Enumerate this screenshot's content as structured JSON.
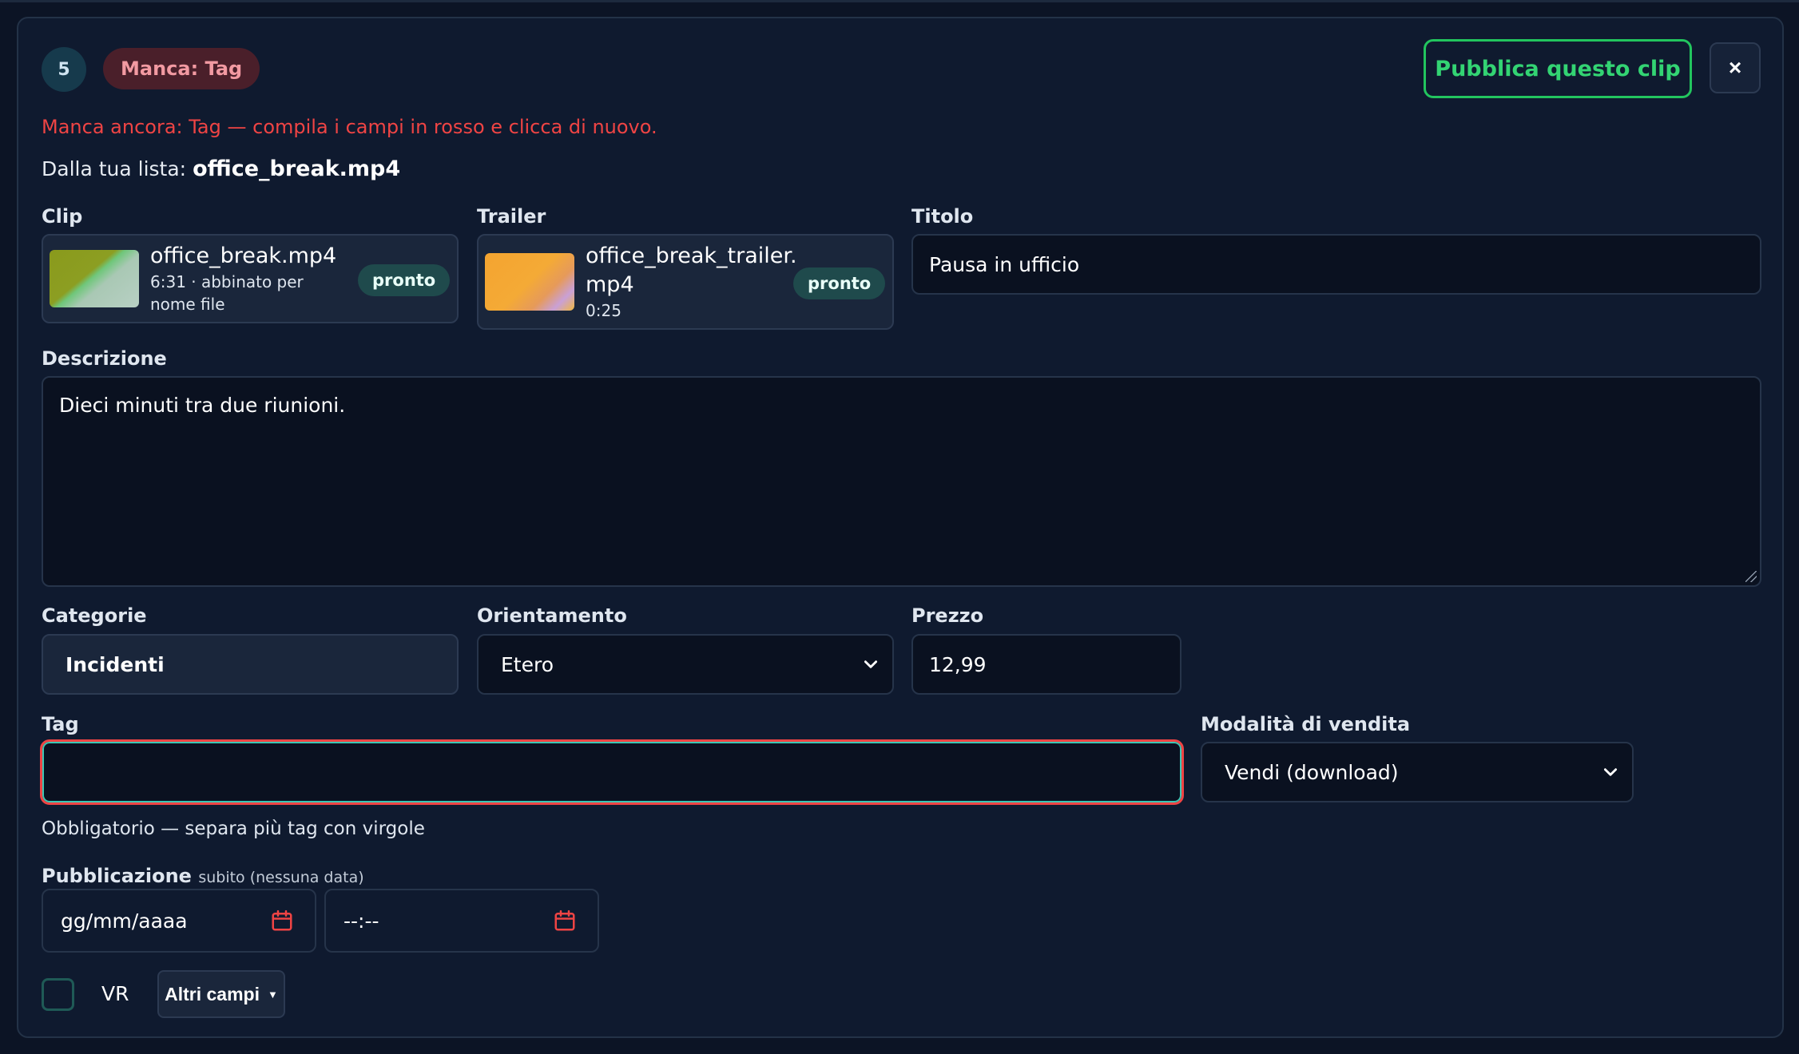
{
  "clip_index": "5",
  "missing_badge": "Manca: Tag",
  "publish_button": "Pubblica questo clip",
  "close_button": "×",
  "error_message": "Manca ancora: Tag — compila i campi in rosso e clicca di nuovo.",
  "from_list": {
    "prefix": "Dalla tua lista:",
    "filename": "office_break.mp4"
  },
  "clip": {
    "label": "Clip",
    "filename": "office_break.mp4",
    "meta_line1": "6:31 · abbinato per",
    "meta_line2": "nome file",
    "status": "pronto"
  },
  "trailer": {
    "label": "Trailer",
    "filename_line1": "office_break_trailer.",
    "filename_line2": "mp4",
    "duration": "0:25",
    "status": "pronto"
  },
  "title": {
    "label": "Titolo",
    "value": "Pausa in ufficio"
  },
  "description": {
    "label": "Descrizione",
    "value": "Dieci minuti tra due riunioni."
  },
  "categories": {
    "label": "Categorie",
    "value": "Incidenti"
  },
  "orientation": {
    "label": "Orientamento",
    "value": "Etero"
  },
  "price": {
    "label": "Prezzo",
    "value": "12,99"
  },
  "tags": {
    "label": "Tag",
    "value": "",
    "hint": "Obbligatorio — separa più tag con virgole"
  },
  "sale_mode": {
    "label": "Modalità di vendita",
    "value": "Vendi (download)"
  },
  "publication": {
    "label": "Pubblicazione",
    "note": "subito (nessuna data)",
    "date_placeholder": "gg/mm/aaaa",
    "time_placeholder": "--:--"
  },
  "vr": {
    "label": "VR",
    "checked": false
  },
  "more_fields_button": "Altri campi",
  "colors": {
    "background": "#0c1425",
    "card": "#0f1a2f",
    "error": "#ef4444",
    "success": "#22c55e",
    "pill": "#1f4a4c"
  },
  "icons": [
    "close-icon",
    "chevron-down-icon",
    "calendar-icon",
    "caret-down-icon"
  ]
}
